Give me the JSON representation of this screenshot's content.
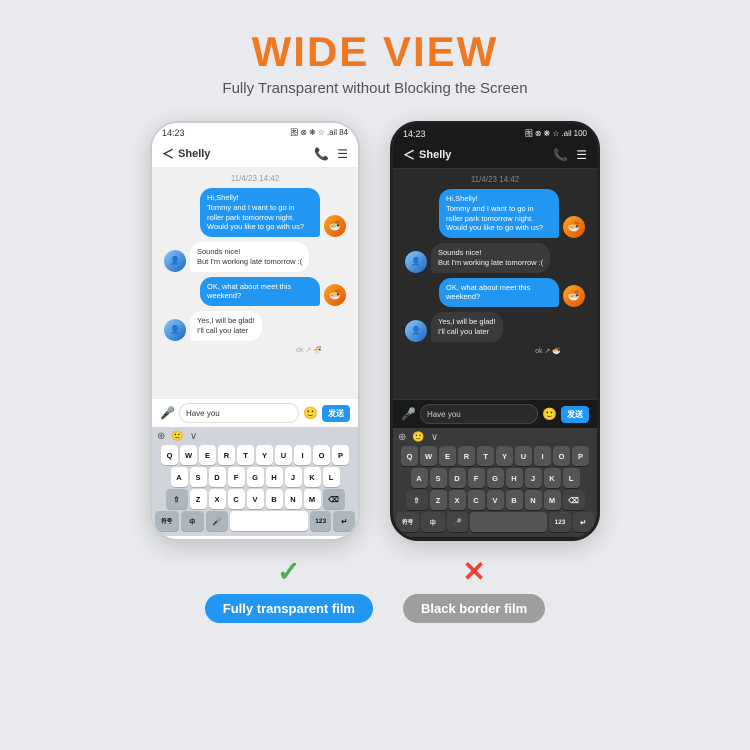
{
  "header": {
    "title": "WIDE VIEW",
    "subtitle": "Fully Transparent without Blocking the Screen"
  },
  "phones": [
    {
      "id": "left-phone",
      "type": "white",
      "status_time": "14:23",
      "status_icons": "图 ⊗ ❋ ☆ .ail 84",
      "contact_name": "Shelly",
      "date_stamp": "11/4/23 14:42",
      "messages": [
        {
          "side": "right",
          "text": "Hi,Shelly!\nTommy and I want to go in roller park tomorrow night. Would you like to go with us?",
          "avatar": "food"
        },
        {
          "side": "left",
          "text": "Sounds nice!\nBut I'm working late tomorrow :(",
          "avatar": "person"
        },
        {
          "side": "right",
          "text": "OK, what about meet this weekend?",
          "avatar": "food"
        },
        {
          "side": "left",
          "text": "Yes,I will be glad!\nI'll call you later",
          "avatar": "person"
        }
      ],
      "ok_text": "ok ↗",
      "input_text": "Have you",
      "send_label": "发送",
      "keys_row1": [
        "Q",
        "W",
        "E",
        "R",
        "T",
        "Y",
        "U",
        "I",
        "O",
        "P"
      ],
      "keys_row2": [
        "A",
        "S",
        "D",
        "F",
        "G",
        "H",
        "J",
        "K",
        "L"
      ],
      "keys_row3": [
        "Z",
        "X",
        "C",
        "V",
        "B",
        "N",
        "M"
      ],
      "bottom_keys": [
        "符号",
        "中",
        "⌨",
        "123",
        "↵"
      ]
    },
    {
      "id": "right-phone",
      "type": "dark",
      "status_time": "14:23",
      "status_icons": "图 ⊗ ❋ ☆ .ail 100",
      "contact_name": "Shelly",
      "date_stamp": "11/4/23 14:42",
      "messages": [
        {
          "side": "right",
          "text": "Hi,Shelly!\nTommy and I want to go in roller park tomorrow night. Would you like to go with us?",
          "avatar": "food"
        },
        {
          "side": "left",
          "text": "Sounds nice!\nBut I'm working late tomorrow :(",
          "avatar": "person"
        },
        {
          "side": "right",
          "text": "OK, what about meet this weekend?",
          "avatar": "food"
        },
        {
          "side": "left",
          "text": "Yes,I will be glad!\nI'll call you later",
          "avatar": "person"
        }
      ],
      "ok_text": "ok ↗",
      "input_text": "Have you",
      "send_label": "发送",
      "keys_row1": [
        "Q",
        "W",
        "E",
        "R",
        "T",
        "Y",
        "U",
        "I",
        "O",
        "P"
      ],
      "keys_row2": [
        "A",
        "S",
        "D",
        "F",
        "G",
        "H",
        "J",
        "K",
        "L"
      ],
      "keys_row3": [
        "Z",
        "X",
        "C",
        "V",
        "B",
        "N",
        "M"
      ],
      "bottom_keys": [
        "符号",
        "中",
        "⌨",
        "123",
        "↵"
      ]
    }
  ],
  "labels": [
    {
      "mark": "✓",
      "mark_type": "check",
      "text": "Fully transparent film",
      "pill_type": "blue"
    },
    {
      "mark": "✕",
      "mark_type": "x",
      "text": "Black border film",
      "pill_type": "gray"
    }
  ]
}
